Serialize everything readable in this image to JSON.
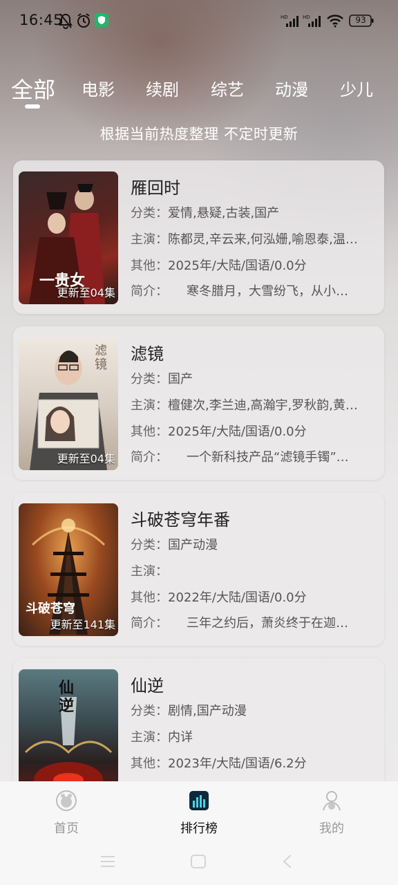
{
  "status_bar": {
    "time": "16:45",
    "battery": "93",
    "icons": [
      "mute-icon",
      "alarm-icon",
      "shield-icon",
      "signal-hd-icon",
      "signal-hd-icon",
      "wifi-icon",
      "battery-icon"
    ]
  },
  "tabs": [
    {
      "label": "全部",
      "active": true
    },
    {
      "label": "电影",
      "active": false
    },
    {
      "label": "续剧",
      "active": false
    },
    {
      "label": "综艺",
      "active": false
    },
    {
      "label": "动漫",
      "active": false
    },
    {
      "label": "少儿",
      "active": false
    }
  ],
  "subtitle": "根据当前热度整理 不定时更新",
  "labels": {
    "category": "分类：",
    "cast": "主演：",
    "other": "其他：",
    "intro": "简介："
  },
  "items": [
    {
      "title": "雁回时",
      "category": "爱情,悬疑,古装,国产",
      "cast": "陈都灵,辛云来,何泓姗,喻恩泰,温…",
      "other": "2025年/大陆/国语/0.0分",
      "intro": "　　寒冬腊月，大雪纷飞，从小…",
      "badge": "更新至04集",
      "poster_text": "一贵女"
    },
    {
      "title": "滤镜",
      "category": "国产",
      "cast": "檀健次,李兰迪,高瀚宇,罗秋韵,黄…",
      "other": "2025年/大陆/国语/0.0分",
      "intro": "　　一个新科技产品“滤镜手镯”…",
      "badge": "更新至04集",
      "poster_text": "滤镜"
    },
    {
      "title": "斗破苍穹年番",
      "category": "国产动漫",
      "cast": "",
      "other": "2022年/大陆/国语/0.0分",
      "intro": "　　三年之约后，萧炎终于在迦…",
      "badge": "更新至141集",
      "poster_text": "斗破苍穹"
    },
    {
      "title": "仙逆",
      "category": "剧情,国产动漫",
      "cast": "内详",
      "other": "2023年/大陆/国语/6.2分",
      "intro": "",
      "badge": "",
      "poster_text": "仙逆"
    }
  ],
  "bottom_nav": [
    {
      "label": "首页",
      "icon": "home-icon",
      "active": false
    },
    {
      "label": "排行榜",
      "icon": "chart-icon",
      "active": true
    },
    {
      "label": "我的",
      "icon": "profile-icon",
      "active": false
    }
  ],
  "system_nav": [
    "menu-icon",
    "home-square-icon",
    "back-icon"
  ]
}
